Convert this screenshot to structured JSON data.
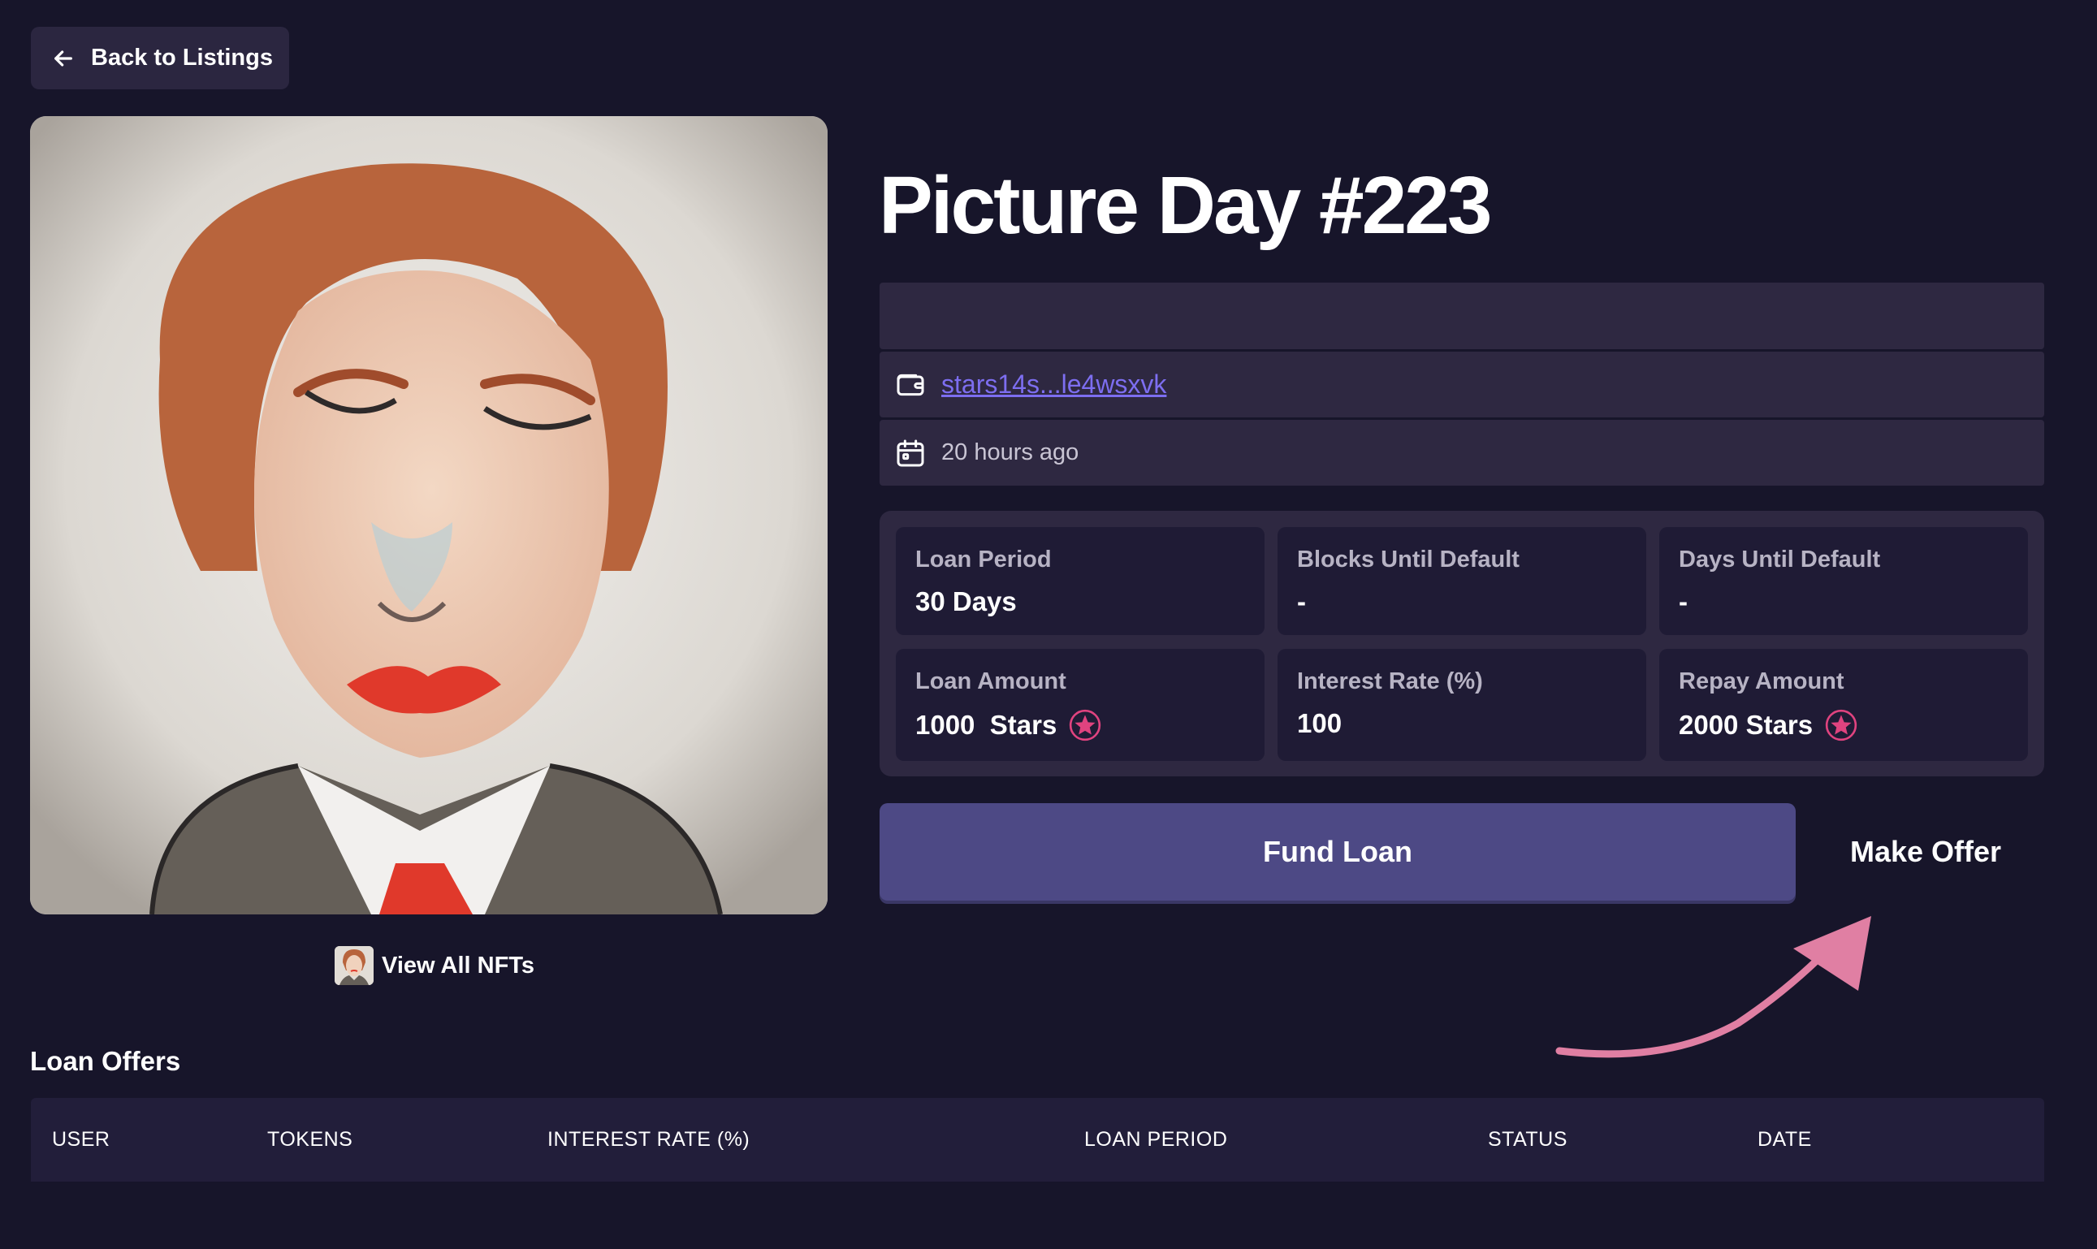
{
  "nav": {
    "back_label": "Back to Listings"
  },
  "nft": {
    "title": "Picture Day #223",
    "owner": "stars14s...le4wsxvk",
    "listed_time": "20 hours ago",
    "view_all_label": "View All NFTs"
  },
  "stats": [
    {
      "label": "Loan Period",
      "value": "30 Days",
      "icon": ""
    },
    {
      "label": "Blocks Until Default",
      "value": "-",
      "icon": ""
    },
    {
      "label": "Days Until Default",
      "value": "-",
      "icon": ""
    },
    {
      "label": "Loan Amount",
      "value": "1000  Stars",
      "icon": "stars-token-icon"
    },
    {
      "label": "Interest Rate (%)",
      "value": "100",
      "icon": ""
    },
    {
      "label": "Repay Amount",
      "value": "2000 Stars",
      "icon": "stars-token-icon"
    }
  ],
  "actions": {
    "fund_label": "Fund Loan",
    "offer_label": "Make Offer"
  },
  "offers": {
    "title": "Loan Offers",
    "columns": [
      "USER",
      "TOKENS",
      "INTEREST RATE (%)",
      "LOAN PERIOD",
      "STATUS",
      "DATE"
    ],
    "rows": []
  },
  "colors": {
    "background": "#17152a",
    "panel": "#2e2841",
    "card": "#1f1b35",
    "primary_button": "#4d4985",
    "link": "#7d6ef0",
    "accent_pink": "#e0437f",
    "annotation_arrow": "#e07fa3"
  }
}
